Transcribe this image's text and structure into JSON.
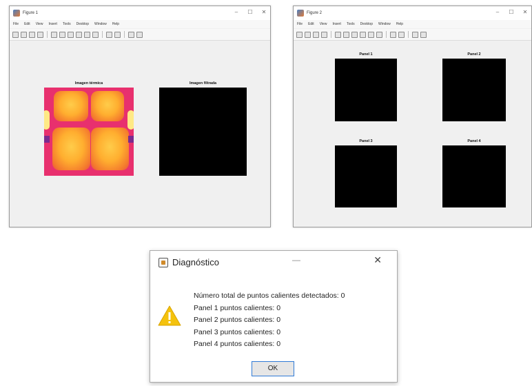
{
  "figure_left": {
    "title": "Figure 1",
    "menu": [
      "File",
      "Edit",
      "View",
      "Insert",
      "Tools",
      "Desktop",
      "Window",
      "Help"
    ],
    "axes_titles": [
      "Imagen térmica",
      "Imagen filtrada"
    ]
  },
  "figure_right": {
    "title": "Figure 2",
    "menu": [
      "File",
      "Edit",
      "View",
      "Insert",
      "Tools",
      "Desktop",
      "Window",
      "Help"
    ],
    "axes_titles": [
      "Panel 1",
      "Panel 2",
      "Panel 3",
      "Panel 4"
    ]
  },
  "dialog": {
    "title": "Diagnóstico",
    "icon": "warning-icon",
    "lines": [
      "Número total de puntos calientes detectados: 0",
      "Panel 1 puntos calientes: 0",
      "Panel 2 puntos calientes: 0",
      "Panel 3 puntos calientes: 0",
      "Panel 4 puntos calientes: 0"
    ],
    "ok_label": "OK"
  },
  "colors": {
    "warning_yellow": "#f4c20d",
    "thermal_base": "#e8306e",
    "thermal_hot": "#ffcc4a",
    "ok_border": "#2f7ad6"
  }
}
